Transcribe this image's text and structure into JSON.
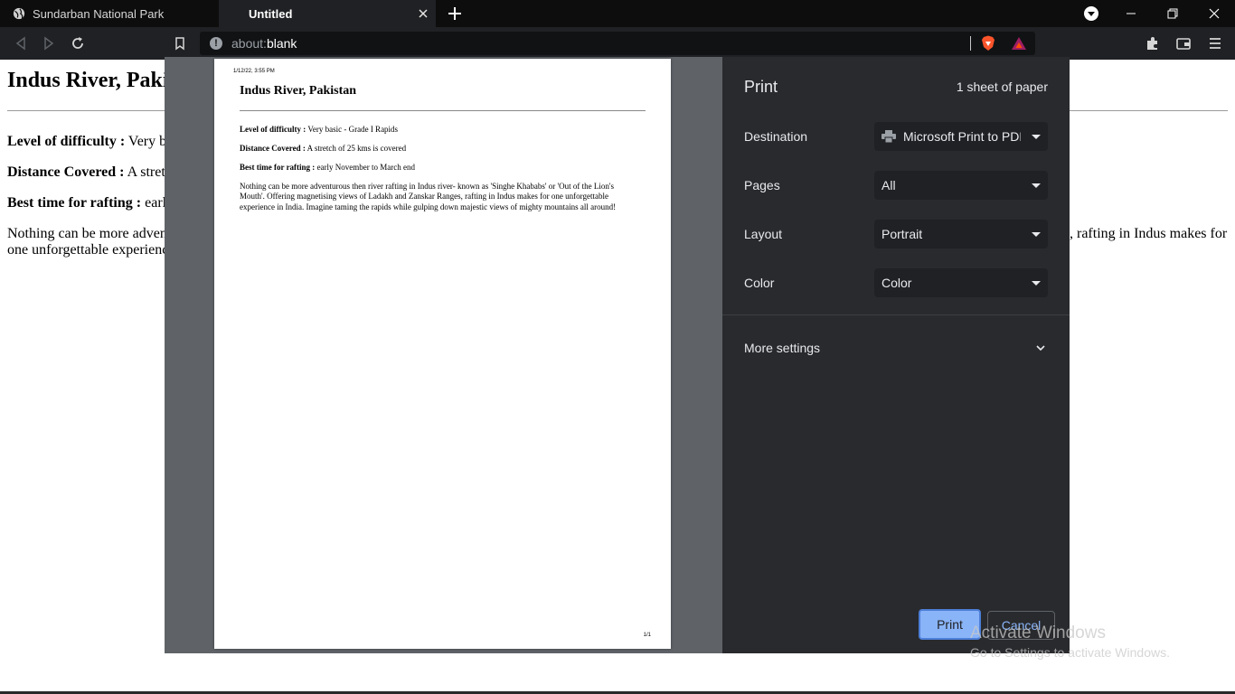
{
  "browser": {
    "tabs": [
      {
        "label": "Sundarban National Park",
        "active": false
      },
      {
        "label": "Untitled",
        "active": true
      }
    ],
    "address": {
      "scheme": "about:",
      "host": "blank"
    }
  },
  "page": {
    "title": "Indus River, Pakistan",
    "title_visible": "Indus River, Paki",
    "rows": [
      {
        "label": "Level of difficulty :",
        "value": "Very b"
      },
      {
        "label": "Distance Covered :",
        "value": "A stret"
      },
      {
        "label": "Best time for rafting :",
        "value": "earl"
      }
    ],
    "para_left_1": "Nothing can be more adven",
    "para_left_2": "one unforgettable experienc",
    "para_right_1": ", rafting in Indus makes for"
  },
  "preview": {
    "timestamp": "1/12/22, 3:55 PM",
    "title": "Indus River, Pakistan",
    "rows": [
      {
        "label": "Level of difficulty :",
        "value": "Very basic - Grade I Rapids"
      },
      {
        "label": "Distance Covered :",
        "value": "A stretch of 25 kms is covered"
      },
      {
        "label": "Best time for rafting :",
        "value": "early November to March end"
      }
    ],
    "paragraph": "Nothing can be more adventurous then river rafting in Indus river- known as 'Singhe Khababs' or 'Out of the Lion's Mouth'. Offering magnetising views of Ladakh and Zanskar Ranges, rafting in Indus makes for one unforgettable experience in India. Imagine taming the rapids while gulping down majestic views of mighty mountains all around!",
    "page_number": "1/1"
  },
  "print": {
    "title": "Print",
    "sheets": "1 sheet of paper",
    "destination_label": "Destination",
    "destination_value": "Microsoft Print to PDF",
    "pages_label": "Pages",
    "pages_value": "All",
    "layout_label": "Layout",
    "layout_value": "Portrait",
    "color_label": "Color",
    "color_value": "Color",
    "more_settings": "More settings",
    "print_button": "Print",
    "cancel_button": "Cancel"
  },
  "watermark": {
    "line1": "Activate Windows",
    "line2": "Go to Settings to activate Windows."
  },
  "colors": {
    "accent": "#8ab4f8",
    "dialog_bg": "#292a2d",
    "preview_bg": "#5f6368"
  }
}
